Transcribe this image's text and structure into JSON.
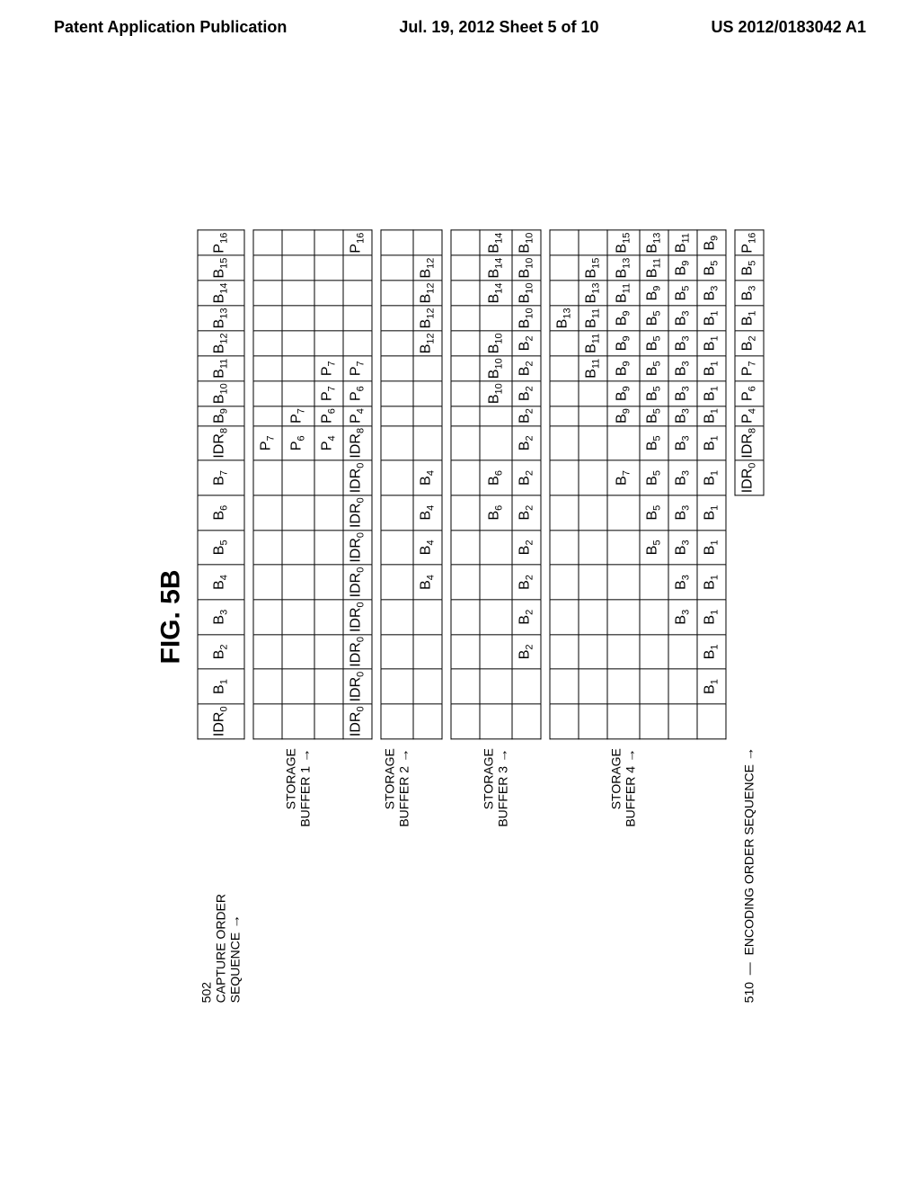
{
  "header": {
    "left": "Patent Application Publication",
    "center": "Jul. 19, 2012  Sheet 5 of 10",
    "right": "US 2012/0183042 A1"
  },
  "figure": {
    "label": "FIG. 5B",
    "ref502": "502",
    "capture_label_line1": "CAPTURE ORDER",
    "capture_label_line2": "SEQUENCE",
    "encoding_ref": "510",
    "encoding_label": "ENCODING ORDER SEQUENCE"
  },
  "cols": [
    "IDR0",
    "B1",
    "B2",
    "B3",
    "B4",
    "B5",
    "B6",
    "B7",
    "IDR8",
    "B9",
    "B10",
    "B11",
    "B12",
    "B13",
    "B14",
    "B15",
    "P16"
  ],
  "buf1": {
    "label": "STORAGE\nBUFFER 1",
    "rows": [
      [
        "",
        "",
        "",
        "",
        "",
        "",
        "",
        "",
        "P7",
        "",
        "",
        "",
        "",
        "",
        "",
        "",
        ""
      ],
      [
        "",
        "",
        "",
        "",
        "",
        "",
        "",
        "",
        "P6",
        "P7",
        "",
        "",
        "",
        "",
        "",
        "",
        ""
      ],
      [
        "",
        "",
        "",
        "",
        "",
        "",
        "",
        "",
        "P4",
        "P6",
        "P7",
        "P7",
        "",
        "",
        "",
        "",
        ""
      ],
      [
        "IDR0",
        "IDR0",
        "IDR0",
        "IDR0",
        "IDR0",
        "IDR0",
        "IDR0",
        "IDR0",
        "IDR8",
        "P4",
        "P6",
        "P7",
        "",
        "",
        "",
        "",
        "P16"
      ]
    ]
  },
  "buf2": {
    "label": "STORAGE\nBUFFER 2",
    "rows": [
      [
        "",
        "",
        "",
        "",
        "",
        "",
        "",
        "",
        "",
        "",
        "",
        "",
        "",
        "",
        "",
        "",
        ""
      ],
      [
        "",
        "",
        "",
        "",
        "B4",
        "B4",
        "B4",
        "B4",
        "",
        "",
        "",
        "",
        "B12",
        "B12",
        "B12",
        "B12",
        ""
      ]
    ]
  },
  "buf3": {
    "label": "STORAGE\nBUFFER 3",
    "rows": [
      [
        "",
        "",
        "",
        "",
        "",
        "",
        "",
        "",
        "",
        "",
        "",
        "",
        "",
        "",
        "",
        "",
        ""
      ],
      [
        "",
        "",
        "",
        "",
        "",
        "",
        "B6",
        "B6",
        "",
        "",
        "B10",
        "B10",
        "B10",
        "",
        "B14",
        "B14",
        "B14"
      ],
      [
        "",
        "",
        "B2",
        "B2",
        "B2",
        "B2",
        "B2",
        "B2",
        "B2",
        "B2",
        "B2",
        "B2",
        "B2",
        "B10",
        "B10",
        "B10",
        "B10"
      ]
    ]
  },
  "buf4": {
    "label": "STORAGE\nBUFFER 4",
    "rows": [
      [
        "",
        "",
        "",
        "",
        "",
        "",
        "",
        "",
        "",
        "",
        "",
        "",
        "",
        "B13",
        "",
        "",
        ""
      ],
      [
        "",
        "",
        "",
        "",
        "",
        "",
        "",
        "",
        "",
        "",
        "",
        "B11",
        "B11",
        "B11",
        "B13",
        "B15",
        ""
      ],
      [
        "",
        "",
        "",
        "",
        "",
        "",
        "",
        "B7",
        "",
        "B9",
        "B9",
        "B9",
        "B9",
        "B9",
        "B11",
        "B13",
        "B15"
      ],
      [
        "",
        "",
        "",
        "",
        "",
        "B5",
        "B5",
        "B5",
        "B5",
        "B5",
        "B5",
        "B5",
        "B5",
        "B5",
        "B9",
        "B11",
        "B13"
      ],
      [
        "",
        "",
        "",
        "B3",
        "B3",
        "B3",
        "B3",
        "B3",
        "B3",
        "B3",
        "B3",
        "B3",
        "B3",
        "B3",
        "B5",
        "B9",
        "B11"
      ],
      [
        "",
        "B1",
        "B1",
        "B1",
        "B1",
        "B1",
        "B1",
        "B1",
        "B1",
        "B1",
        "B1",
        "B1",
        "B1",
        "B1",
        "B3",
        "B5",
        "B9"
      ]
    ]
  },
  "encoding_row": [
    "IDR0",
    "IDR8",
    "P4",
    "P6",
    "P7",
    "B2",
    "B1",
    "B3",
    "B5",
    "P16"
  ],
  "chart_data": {
    "type": "table",
    "title": "FIG. 5B — Capture order sequence vs storage buffers and encoding order",
    "capture_order_sequence": [
      "IDR0",
      "B1",
      "B2",
      "B3",
      "B4",
      "B5",
      "B6",
      "B7",
      "IDR8",
      "B9",
      "B10",
      "B11",
      "B12",
      "B13",
      "B14",
      "B15",
      "P16"
    ],
    "storage_buffer_1": [
      [
        "",
        "",
        "",
        "",
        "",
        "",
        "",
        "",
        "P7",
        "",
        "",
        "",
        "",
        "",
        "",
        "",
        ""
      ],
      [
        "",
        "",
        "",
        "",
        "",
        "",
        "",
        "",
        "P6",
        "P7",
        "",
        "",
        "",
        "",
        "",
        "",
        ""
      ],
      [
        "",
        "",
        "",
        "",
        "",
        "",
        "",
        "",
        "P4",
        "P6",
        "P7",
        "P7",
        "",
        "",
        "",
        "",
        ""
      ],
      [
        "IDR0",
        "IDR0",
        "IDR0",
        "IDR0",
        "IDR0",
        "IDR0",
        "IDR0",
        "IDR0",
        "IDR8",
        "P4",
        "P6",
        "P7",
        "",
        "",
        "",
        "",
        "P16"
      ]
    ],
    "storage_buffer_2": [
      [
        "",
        "",
        "",
        "",
        "",
        "",
        "",
        "",
        "",
        "",
        "",
        "",
        "",
        "",
        "",
        "",
        ""
      ],
      [
        "",
        "",
        "",
        "",
        "B4",
        "B4",
        "B4",
        "B4",
        "",
        "",
        "",
        "",
        "B12",
        "B12",
        "B12",
        "B12",
        ""
      ]
    ],
    "storage_buffer_3": [
      [
        "",
        "",
        "",
        "",
        "",
        "",
        "",
        "",
        "",
        "",
        "",
        "",
        "",
        "",
        "",
        "",
        ""
      ],
      [
        "",
        "",
        "",
        "",
        "",
        "",
        "B6",
        "B6",
        "",
        "",
        "B10",
        "B10",
        "B10",
        "",
        "B14",
        "B14",
        "B14"
      ],
      [
        "",
        "",
        "B2",
        "B2",
        "B2",
        "B2",
        "B2",
        "B2",
        "B2",
        "B2",
        "B2",
        "B2",
        "B2",
        "B10",
        "B10",
        "B10",
        "B10"
      ]
    ],
    "storage_buffer_4": [
      [
        "",
        "",
        "",
        "",
        "",
        "",
        "",
        "",
        "",
        "",
        "",
        "",
        "",
        "B13",
        "",
        "",
        ""
      ],
      [
        "",
        "",
        "",
        "",
        "",
        "",
        "",
        "",
        "",
        "",
        "",
        "B11",
        "B11",
        "B11",
        "B13",
        "B15",
        ""
      ],
      [
        "",
        "",
        "",
        "",
        "",
        "",
        "",
        "B7",
        "",
        "B9",
        "B9",
        "B9",
        "B9",
        "B9",
        "B11",
        "B13",
        "B15"
      ],
      [
        "",
        "",
        "",
        "",
        "",
        "B5",
        "B5",
        "B5",
        "B5",
        "B5",
        "B5",
        "B5",
        "B5",
        "B5",
        "B9",
        "B11",
        "B13"
      ],
      [
        "",
        "",
        "",
        "B3",
        "B3",
        "B3",
        "B3",
        "B3",
        "B3",
        "B3",
        "B3",
        "B3",
        "B3",
        "B3",
        "B5",
        "B9",
        "B11"
      ],
      [
        "",
        "B1",
        "B1",
        "B1",
        "B1",
        "B1",
        "B1",
        "B1",
        "B1",
        "B1",
        "B1",
        "B1",
        "B1",
        "B1",
        "B3",
        "B5",
        "B9"
      ]
    ],
    "encoding_order_sequence": [
      "IDR0",
      "IDR8",
      "P4",
      "P6",
      "P7",
      "B2",
      "B1",
      "B3",
      "B5",
      "P16"
    ]
  }
}
